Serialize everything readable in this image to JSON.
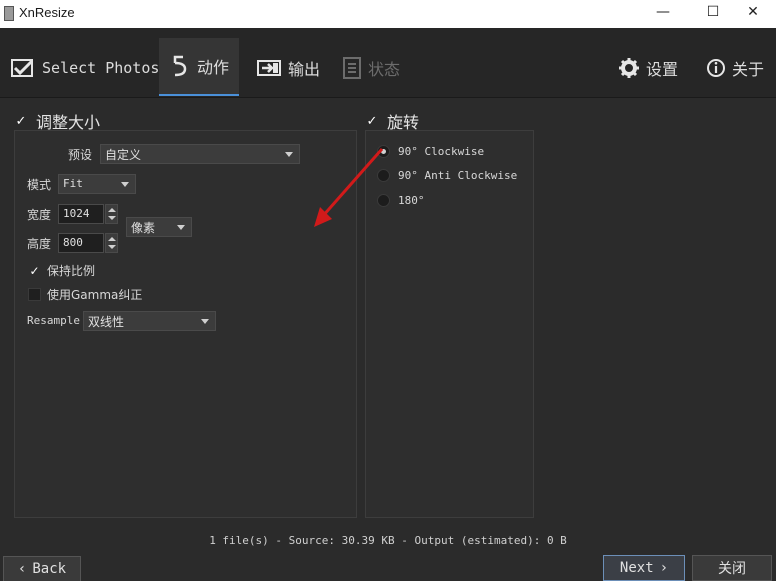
{
  "window": {
    "title": "XnResize",
    "minimize": "—",
    "maximize": "☐",
    "close": "✕"
  },
  "toolbar": {
    "tabs": [
      {
        "label": "Select Photos",
        "icon": "image-check-icon"
      },
      {
        "label": "动作",
        "icon": "action-arrow-icon"
      },
      {
        "label": "输出",
        "icon": "output-icon"
      },
      {
        "label": "状态",
        "icon": "list-icon"
      }
    ],
    "settings_label": "设置",
    "about_label": "关于",
    "active_tab": "动作"
  },
  "resize": {
    "section_title": "调整大小",
    "checked": true,
    "preset_label": "预设",
    "preset_value": "自定义",
    "mode_label": "模式",
    "mode_value": "Fit",
    "width_label": "宽度",
    "width_value": "1024",
    "height_label": "高度",
    "height_value": "800",
    "unit_value": "像素",
    "keep_ratio_label": "保持比例",
    "keep_ratio_checked": true,
    "gamma_label": "使用Gamma纠正",
    "gamma_checked": false,
    "resample_label": "Resample",
    "resample_value": "双线性"
  },
  "rotate": {
    "section_title": "旋转",
    "checked": true,
    "options": [
      {
        "label": "90°  Clockwise",
        "selected": true
      },
      {
        "label": "90°  Anti Clockwise",
        "selected": false
      },
      {
        "label": "180°",
        "selected": false
      }
    ]
  },
  "status_text": "1 file(s) - Source: 30.39 KB - Output (estimated): 0 B",
  "buttons": {
    "back": "Back",
    "next": "Next",
    "close": "关闭"
  },
  "colors": {
    "background": "#2b2b2b",
    "toolbar": "#262626",
    "active_tab_accent": "#4a90d9",
    "annotation_arrow": "#d11a1a"
  }
}
